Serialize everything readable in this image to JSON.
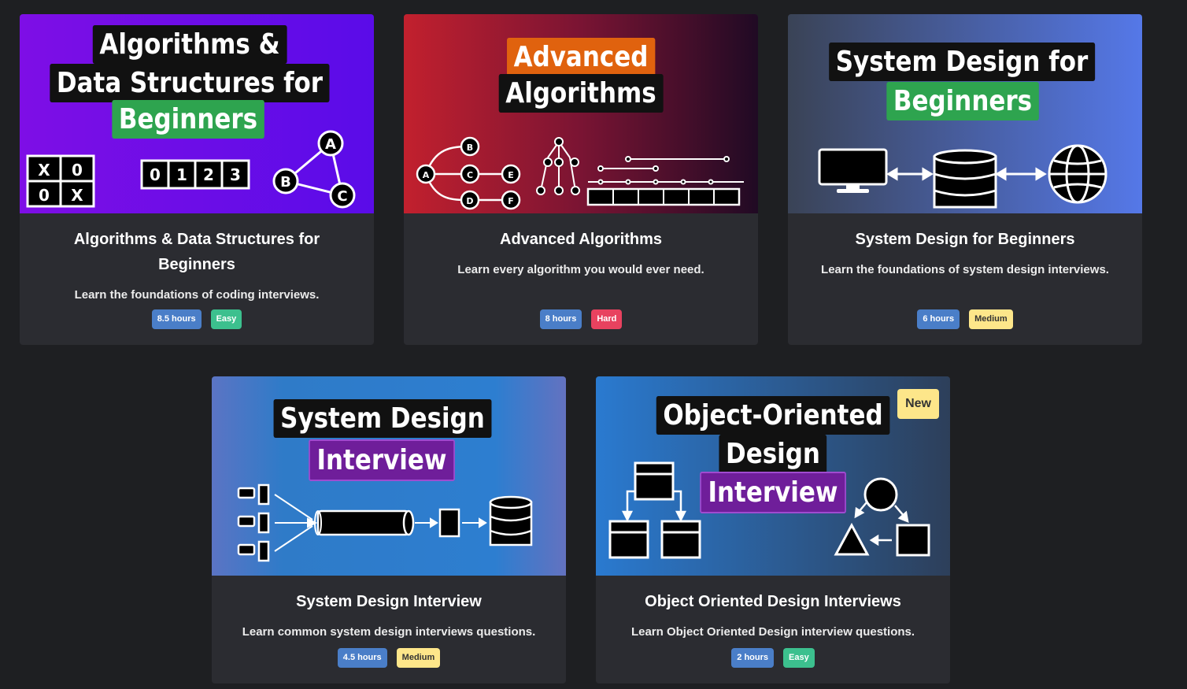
{
  "courses": [
    {
      "thumb_lines": [
        "Algorithms &",
        "Data Structures for",
        "Beginners"
      ],
      "title": "Algorithms & Data Structures for Beginners",
      "description": "Learn the foundations of coding interviews.",
      "duration": "8.5 hours",
      "difficulty": "Easy",
      "graphics": {
        "tictactoe": [
          "X",
          "0",
          "0",
          "X"
        ],
        "array": [
          "0",
          "1",
          "2",
          "3"
        ],
        "graph_nodes": [
          "A",
          "B",
          "C"
        ]
      }
    },
    {
      "thumb_lines": [
        "Advanced",
        "Algorithms"
      ],
      "title": "Advanced Algorithms",
      "description": "Learn every algorithm you would ever need.",
      "duration": "8 hours",
      "difficulty": "Hard",
      "graphics": {
        "tree_nodes": [
          "A",
          "B",
          "C",
          "D",
          "E",
          "F"
        ]
      }
    },
    {
      "thumb_lines": [
        "System Design for",
        "Beginners"
      ],
      "title": "System Design for Beginners",
      "description": "Learn the foundations of system design interviews.",
      "duration": "6 hours",
      "difficulty": "Medium"
    },
    {
      "thumb_lines": [
        "System Design",
        "Interview"
      ],
      "title": "System Design Interview",
      "description": "Learn common system design interviews questions.",
      "duration": "4.5 hours",
      "difficulty": "Medium"
    },
    {
      "thumb_lines": [
        "Object-Oriented",
        "Design",
        "Interview"
      ],
      "title": "Object Oriented Design Interviews",
      "description": "Learn Object Oriented Design interview questions.",
      "duration": "2 hours",
      "difficulty": "Easy",
      "new_label": "New"
    }
  ],
  "colors": {
    "page_bg": "#1e1f22",
    "card_bg": "#2b2c31",
    "badge_time": "#4a7ec8",
    "badge_easy": "#3cc08e",
    "badge_hard": "#e8425f",
    "badge_medium": "#fde68a"
  }
}
